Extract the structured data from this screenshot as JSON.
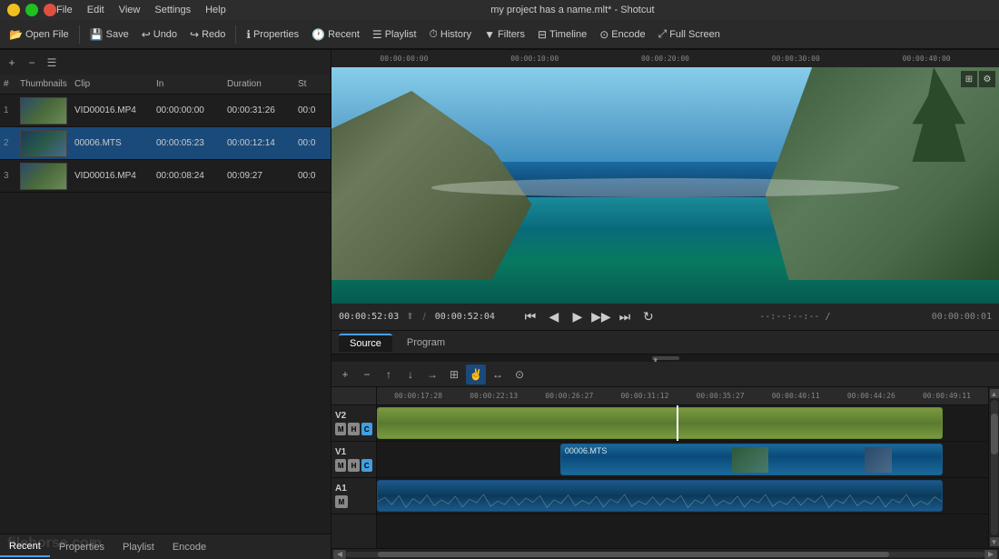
{
  "titlebar": {
    "title": "my project has a name.mlt* - Shotcut",
    "menu": [
      "File",
      "Edit",
      "View",
      "Settings",
      "Help"
    ],
    "win_controls": [
      "minimize",
      "maximize",
      "close"
    ]
  },
  "toolbar": {
    "buttons": [
      {
        "id": "open-file",
        "label": "Open File",
        "icon": "📂"
      },
      {
        "id": "save",
        "label": "Save",
        "icon": "💾"
      },
      {
        "id": "undo",
        "label": "Undo",
        "icon": "↩"
      },
      {
        "id": "redo",
        "label": "Redo",
        "icon": "↪"
      },
      {
        "id": "properties",
        "label": "Properties",
        "icon": "ℹ"
      },
      {
        "id": "recent",
        "label": "Recent",
        "icon": "🕐"
      },
      {
        "id": "playlist",
        "label": "Playlist",
        "icon": "☰"
      },
      {
        "id": "history",
        "label": "History",
        "icon": "⏱"
      },
      {
        "id": "filters",
        "label": "Filters",
        "icon": "⧖"
      },
      {
        "id": "timeline",
        "label": "Timeline",
        "icon": "⏹"
      },
      {
        "id": "encode",
        "label": "Encode",
        "icon": "⊙"
      },
      {
        "id": "fullscreen",
        "label": "Full Screen",
        "icon": "⤢"
      }
    ]
  },
  "playlist": {
    "columns": [
      "#",
      "Thumbnails",
      "Clip",
      "In",
      "Duration",
      "St"
    ],
    "rows": [
      {
        "num": "1",
        "clip": "VID00016.MP4",
        "in": "00:00:00:00",
        "duration": "00:00:31:26",
        "st": "00:0"
      },
      {
        "num": "2",
        "clip": "00006.MTS",
        "in": "00:00:05:23",
        "duration": "00:00:12:14",
        "st": "00:0"
      },
      {
        "num": "3",
        "clip": "VID00016.MP4",
        "in": "00:00:08:24",
        "duration": "00:09:27",
        "st": "00:0"
      }
    ]
  },
  "left_tabs": {
    "tabs": [
      "Recent",
      "Properties",
      "Playlist",
      "Encode"
    ]
  },
  "preview": {
    "timecode": "00:00:52:03",
    "total": "00:00:52:04",
    "right_time": "--:--:--:-- /",
    "end_time": "00:00:00:01",
    "ruler_marks": [
      "00:00:00:00",
      "00:00:10:00",
      "00:00:20:00",
      "00:00:30:00",
      "00:00:40:00"
    ]
  },
  "source_program": {
    "tabs": [
      "Source",
      "Program"
    ],
    "active": "Source"
  },
  "timeline": {
    "toolbar_btns": [
      "+",
      "-",
      "↑",
      "↓",
      "→",
      "⊞",
      "✌",
      "↔",
      "⊙"
    ],
    "ruler_marks": [
      "00:00:17:28",
      "00:00:22:13",
      "00:00:26:27",
      "00:00:31:12",
      "00:00:35:27",
      "00:00:40:11",
      "00:00:44:26",
      "00:00:49:11"
    ],
    "tracks": [
      {
        "name": "V2",
        "type": "video"
      },
      {
        "name": "V1",
        "type": "video"
      },
      {
        "name": "A1",
        "type": "audio"
      }
    ],
    "clip_label": "00006.MTS"
  },
  "watermark": "filehorse.com"
}
